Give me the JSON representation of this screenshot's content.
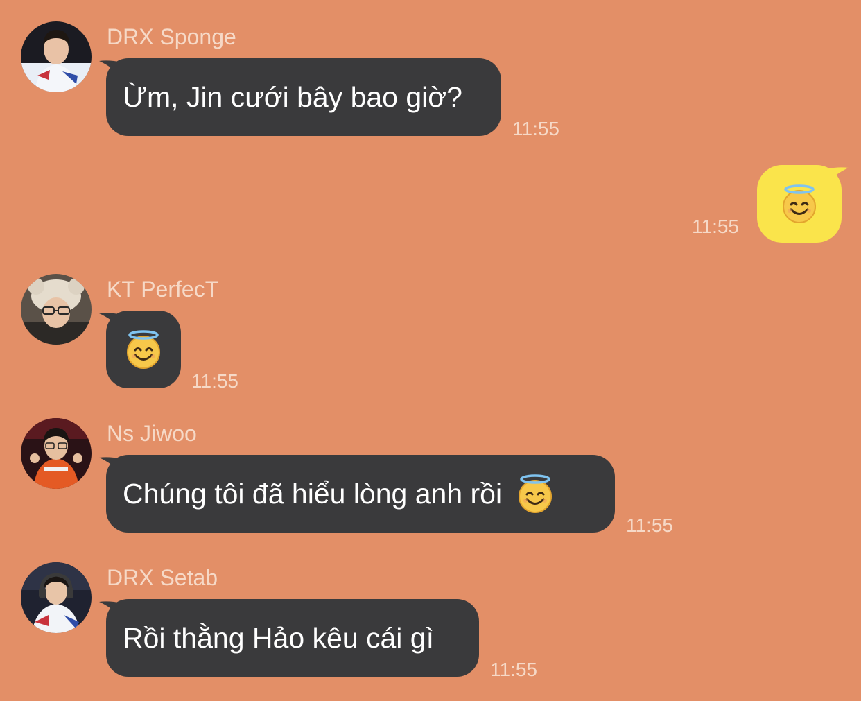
{
  "theme": {
    "background": "#E38F67",
    "incoming_bubble": "#3A3A3C",
    "outgoing_bubble": "#FAE44B",
    "meta_text": "#F6D9C7"
  },
  "messages": [
    {
      "direction": "incoming",
      "sender": "DRX Sponge",
      "avatar": "avatar-photo",
      "text": "Ừm, Jin cưới bây bao giờ?",
      "time": "11:55"
    },
    {
      "direction": "outgoing",
      "emoji": "smiling-face-with-halo",
      "time": "11:55"
    },
    {
      "direction": "incoming",
      "sender": "KT PerfecT",
      "avatar": "avatar-photo",
      "emoji": "smiling-face-with-halo",
      "time": "11:55"
    },
    {
      "direction": "incoming",
      "sender": "Ns Jiwoo",
      "avatar": "avatar-photo",
      "text": "Chúng tôi đã hiểu lòng anh rồi",
      "emoji": "smiling-face-with-halo",
      "time": "11:55"
    },
    {
      "direction": "incoming",
      "sender": "DRX Setab",
      "avatar": "avatar-photo",
      "text": "Rồi thằng Hảo kêu cái gì",
      "time": "11:55"
    }
  ]
}
